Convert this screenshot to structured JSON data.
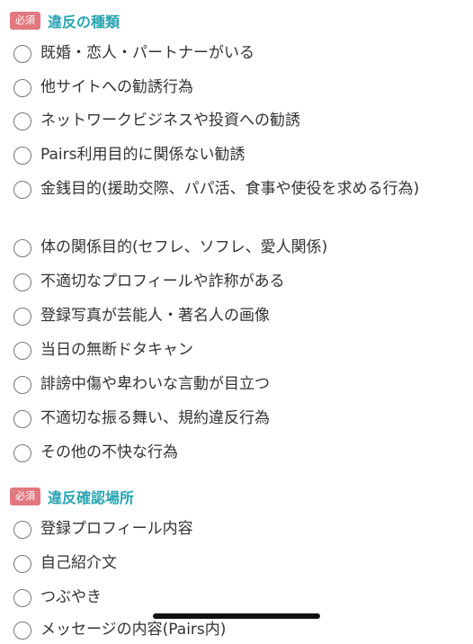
{
  "violation_type": {
    "badge": "必須",
    "title": "違反の種類",
    "options": [
      "既婚・恋人・パートナーがいる",
      "他サイトへの勧誘行為",
      "ネットワークビジネスや投資への勧誘",
      "Pairs利用目的に関係ない勧誘",
      "金銭目的(援助交際、パパ活、食事や使役を求める行為)",
      "体の関係目的(セフレ、ソフレ、愛人関係)",
      "不適切なプロフィールや詐称がある",
      "登録写真が芸能人・著名人の画像",
      "当日の無断ドタキャン",
      "誹謗中傷や卑わいな言動が目立つ",
      "不適切な振る舞い、規約違反行為",
      "その他の不快な行為"
    ]
  },
  "violation_location": {
    "badge": "必須",
    "title": "違反確認場所",
    "options": [
      "登録プロフィール内容",
      "自己紹介文",
      "つぶやき",
      "メッセージの内容(Pairs内)"
    ]
  },
  "colors": {
    "badge_bg": "#e0787e",
    "section_title": "#2aa4b2",
    "radio_border": "#777777"
  }
}
